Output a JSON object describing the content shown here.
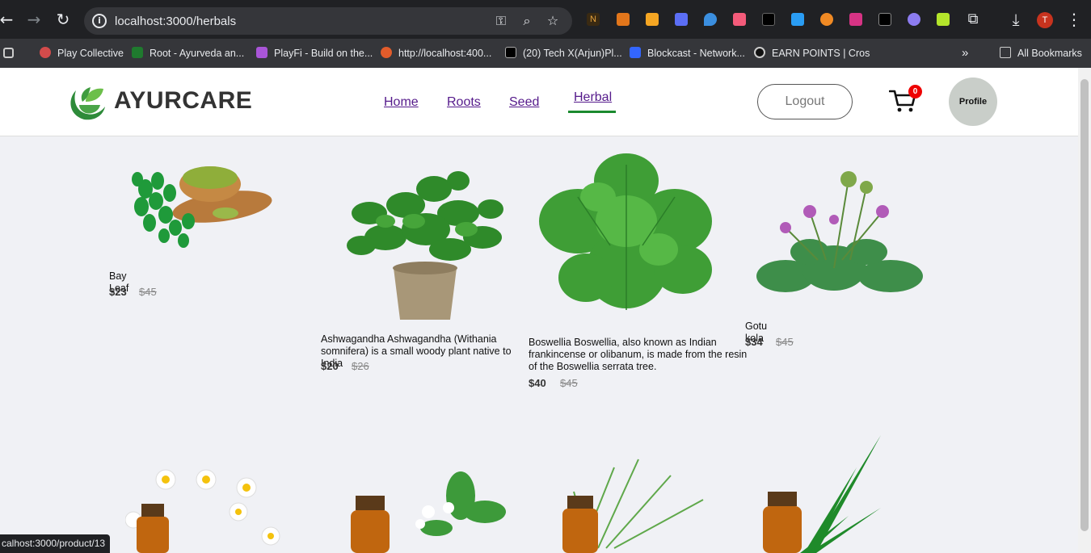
{
  "browser": {
    "url": "localhost:3000/herbals",
    "bookmarks": [
      "Play Collective",
      "Root - Ayurveda an...",
      "PlayFi - Build on the...",
      "http://localhost:400...",
      "(20) Tech X(Arjun)Pl...",
      "Blockcast - Network...",
      "EARN POINTS | Cros"
    ],
    "all_bookmarks": "All Bookmarks",
    "avatar_letter": "T",
    "status_url": "calhost:3000/product/13"
  },
  "header": {
    "brand": "AYURCARE",
    "nav": [
      "Home",
      "Roots",
      "Seed",
      "Herbal"
    ],
    "active_nav": "Herbal",
    "logout": "Logout",
    "cart_count": "0",
    "profile": "Profile"
  },
  "products": [
    {
      "name": "Bay Leaf",
      "price": "$23",
      "old_price": "$45"
    },
    {
      "name": "Ashwagandha Ashwagandha (Withania somnifera) is a small woody plant native to India",
      "price": "$20",
      "old_price": "$26"
    },
    {
      "name": "Boswellia Boswellia, also known as Indian frankincense or olibanum, is made from the resin of the Boswellia serrata tree.",
      "price": "$40",
      "old_price": "$45"
    },
    {
      "name": "Gotu kola",
      "price": "$34",
      "old_price": "$45"
    }
  ],
  "colors": {
    "accent_green": "#1b8a2f",
    "nav_link": "#551a8b",
    "badge_red": "#ee0000",
    "page_bg": "#f0f1f5"
  }
}
